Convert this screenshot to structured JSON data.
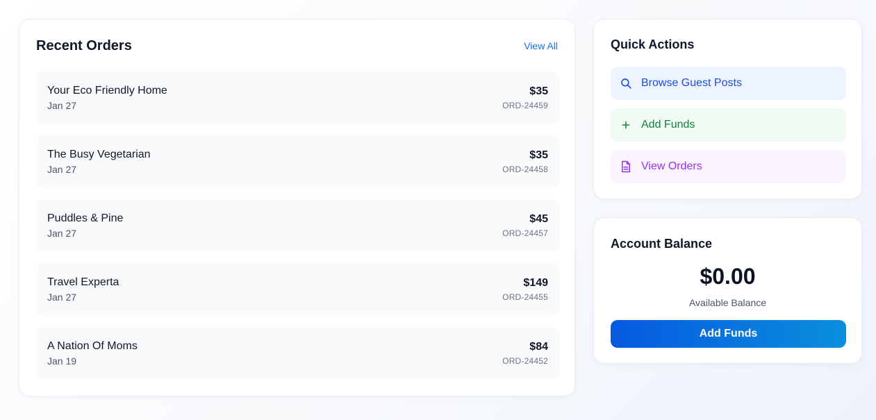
{
  "recent_orders": {
    "title": "Recent Orders",
    "view_all": "View All",
    "orders": [
      {
        "name": "Your Eco Friendly Home",
        "date": "Jan 27",
        "price": "$35",
        "id": "ORD-24459"
      },
      {
        "name": "The Busy Vegetarian",
        "date": "Jan 27",
        "price": "$35",
        "id": "ORD-24458"
      },
      {
        "name": "Puddles & Pine",
        "date": "Jan 27",
        "price": "$45",
        "id": "ORD-24457"
      },
      {
        "name": "Travel Experta",
        "date": "Jan 27",
        "price": "$149",
        "id": "ORD-24455"
      },
      {
        "name": "A Nation Of Moms",
        "date": "Jan 19",
        "price": "$84",
        "id": "ORD-24452"
      }
    ]
  },
  "quick_actions": {
    "title": "Quick Actions",
    "items": [
      {
        "label": "Browse Guest Posts",
        "icon": "search-icon",
        "color": "#1d4ed8"
      },
      {
        "label": "Add Funds",
        "icon": "plus-icon",
        "color": "#15803d"
      },
      {
        "label": "View Orders",
        "icon": "document-icon",
        "color": "#9333ea"
      }
    ]
  },
  "account_balance": {
    "title": "Account Balance",
    "amount": "$0.00",
    "label": "Available Balance",
    "button": "Add Funds"
  },
  "colors": {
    "link": "#1d6fe0",
    "button_gradient_start": "#0659e0",
    "button_gradient_end": "#0a8fdc"
  }
}
